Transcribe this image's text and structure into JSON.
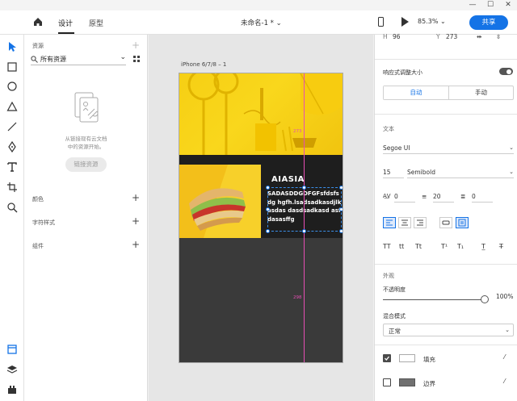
{
  "window": {
    "minimize": "—",
    "maximize": "☐",
    "close": "✕"
  },
  "topbar": {
    "tabs": [
      {
        "label": "设计",
        "active": true
      },
      {
        "label": "原型",
        "active": false
      }
    ],
    "doc_title": "未命名-1 *",
    "zoom": "85.3%",
    "share_label": "共享"
  },
  "assets": {
    "section_title": "资源",
    "filter_label": "所有资源",
    "empty_message_line1": "从链接现有云文档",
    "empty_message_line2": "中的资源开始。",
    "link_button": "链接资源",
    "groups": [
      "颜色",
      "字符样式",
      "组件"
    ]
  },
  "canvas": {
    "artboard_title": "iPhone 6/7/8 – 1",
    "card_title": "AIASIA",
    "card_body": "SADASDDGDFGFsfdsfsdg hgfh.lsadsadkasdjlkasdas dasdsadkasd asfdasasffg",
    "guide_label_top": "273",
    "guide_label_bottom": "298"
  },
  "props": {
    "h_label": "H",
    "h_value": "96",
    "y_label": "Y",
    "y_value": "273",
    "responsive_label": "响应式调整大小",
    "responsive_on": true,
    "auto_label": "自动",
    "manual_label": "手动",
    "text_section": "文本",
    "font_family": "Segoe UI",
    "font_size": "15",
    "font_weight": "Semibold",
    "char_spacing": "0",
    "line_spacing": "20",
    "para_spacing": "0",
    "text_styles": [
      "TT",
      "tt",
      "Tt",
      "T¹",
      "T₁",
      "T̲",
      "T̶"
    ],
    "appearance_section": "外观",
    "opacity_label": "不透明度",
    "opacity_value": "100%",
    "blend_label": "混合模式",
    "blend_value": "正常",
    "fill_label": "填充",
    "fill_checked": true,
    "fill_color": "#ffffff",
    "border_label": "边界",
    "border_checked": false,
    "border_color": "#707070"
  },
  "colors": {
    "accent": "#1473e6",
    "guide": "#e64eb4"
  }
}
